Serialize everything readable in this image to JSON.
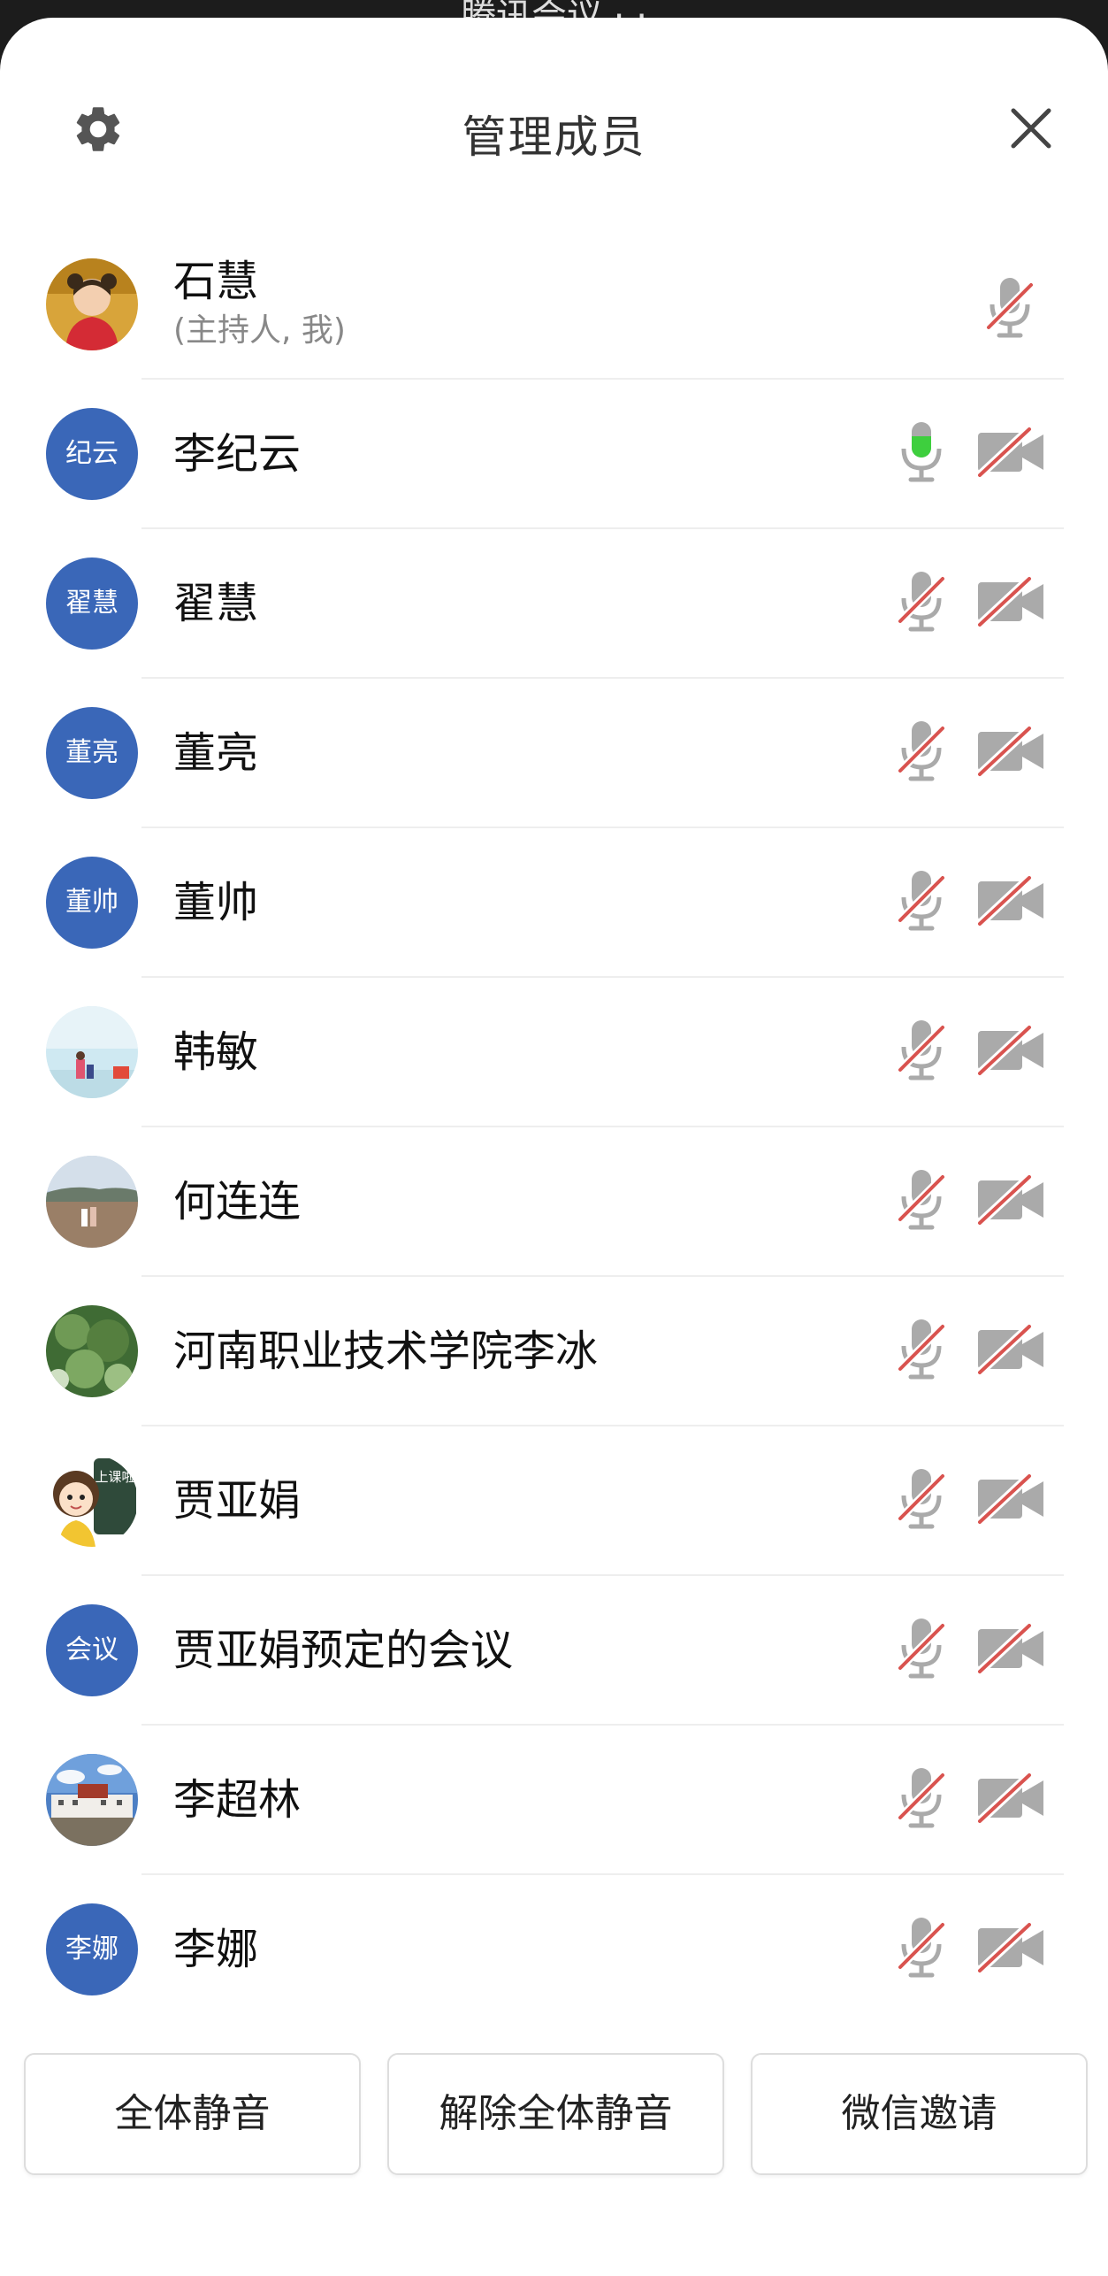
{
  "status": {
    "partial_text": "腾讯会议 · ·"
  },
  "header": {
    "title": "管理成员",
    "left_icon": "gear-icon",
    "right_icon": "close-icon"
  },
  "colors": {
    "avatar_blue": "#3a67b8",
    "mic_active": "#3ecf3e",
    "strike_red": "#d9534f",
    "icon_gray": "#aaaaaa"
  },
  "members": [
    {
      "name": "石慧",
      "role": "(主持人, 我)",
      "avatar_text": "",
      "avatar_photo": "child-portrait",
      "mic": "muted",
      "cam": null
    },
    {
      "name": "李纪云",
      "role": "",
      "avatar_text": "纪云",
      "mic": "active",
      "cam": "off"
    },
    {
      "name": "翟慧",
      "role": "",
      "avatar_text": "翟慧",
      "mic": "muted",
      "cam": "off"
    },
    {
      "name": "董亮",
      "role": "",
      "avatar_text": "董亮",
      "mic": "muted",
      "cam": "off"
    },
    {
      "name": "董帅",
      "role": "",
      "avatar_text": "董帅",
      "mic": "muted",
      "cam": "off"
    },
    {
      "name": "韩敏",
      "role": "",
      "avatar_text": "",
      "avatar_photo": "beach",
      "mic": "muted",
      "cam": "off"
    },
    {
      "name": "何连连",
      "role": "",
      "avatar_text": "",
      "avatar_photo": "seaside",
      "mic": "muted",
      "cam": "off"
    },
    {
      "name": "河南职业技术学院李冰",
      "role": "",
      "avatar_text": "",
      "avatar_photo": "tree",
      "mic": "muted",
      "cam": "off"
    },
    {
      "name": "贾亚娟",
      "role": "",
      "avatar_text": "",
      "avatar_photo": "cartoon-teacher",
      "avatar_caption": "上课啦",
      "mic": "muted",
      "cam": "off"
    },
    {
      "name": "贾亚娟预定的会议",
      "role": "",
      "avatar_text": "会议",
      "mic": "muted",
      "cam": "off"
    },
    {
      "name": "李超林",
      "role": "",
      "avatar_text": "",
      "avatar_photo": "palace",
      "mic": "muted",
      "cam": "off"
    },
    {
      "name": "李娜",
      "role": "",
      "avatar_text": "李娜",
      "mic": "muted",
      "cam": "off"
    }
  ],
  "footer": {
    "mute_all": "全体静音",
    "unmute_all": "解除全体静音",
    "wechat_invite": "微信邀请"
  }
}
